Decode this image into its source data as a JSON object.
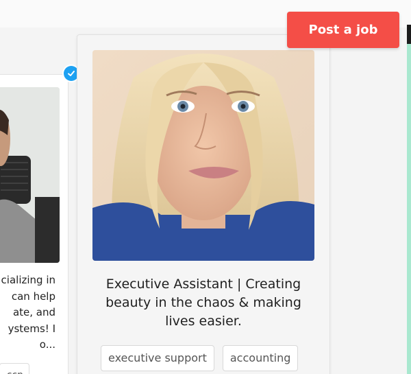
{
  "header": {
    "post_job_label": "Post a job"
  },
  "profile_left": {
    "bio_partial": "cializing in\ncan help\nate, and\nystems! I\no...",
    "tag_partial": "ccn",
    "verified_icon": "verified-check-icon"
  },
  "profile_main": {
    "headline": "Executive Assistant | Creating beauty in the chaos & making lives easier.",
    "tags": [
      "executive support",
      "accounting"
    ]
  },
  "colors": {
    "accent": "#f44e47",
    "verified": "#1da1f2",
    "mint_edge": "#a9e8cf"
  }
}
